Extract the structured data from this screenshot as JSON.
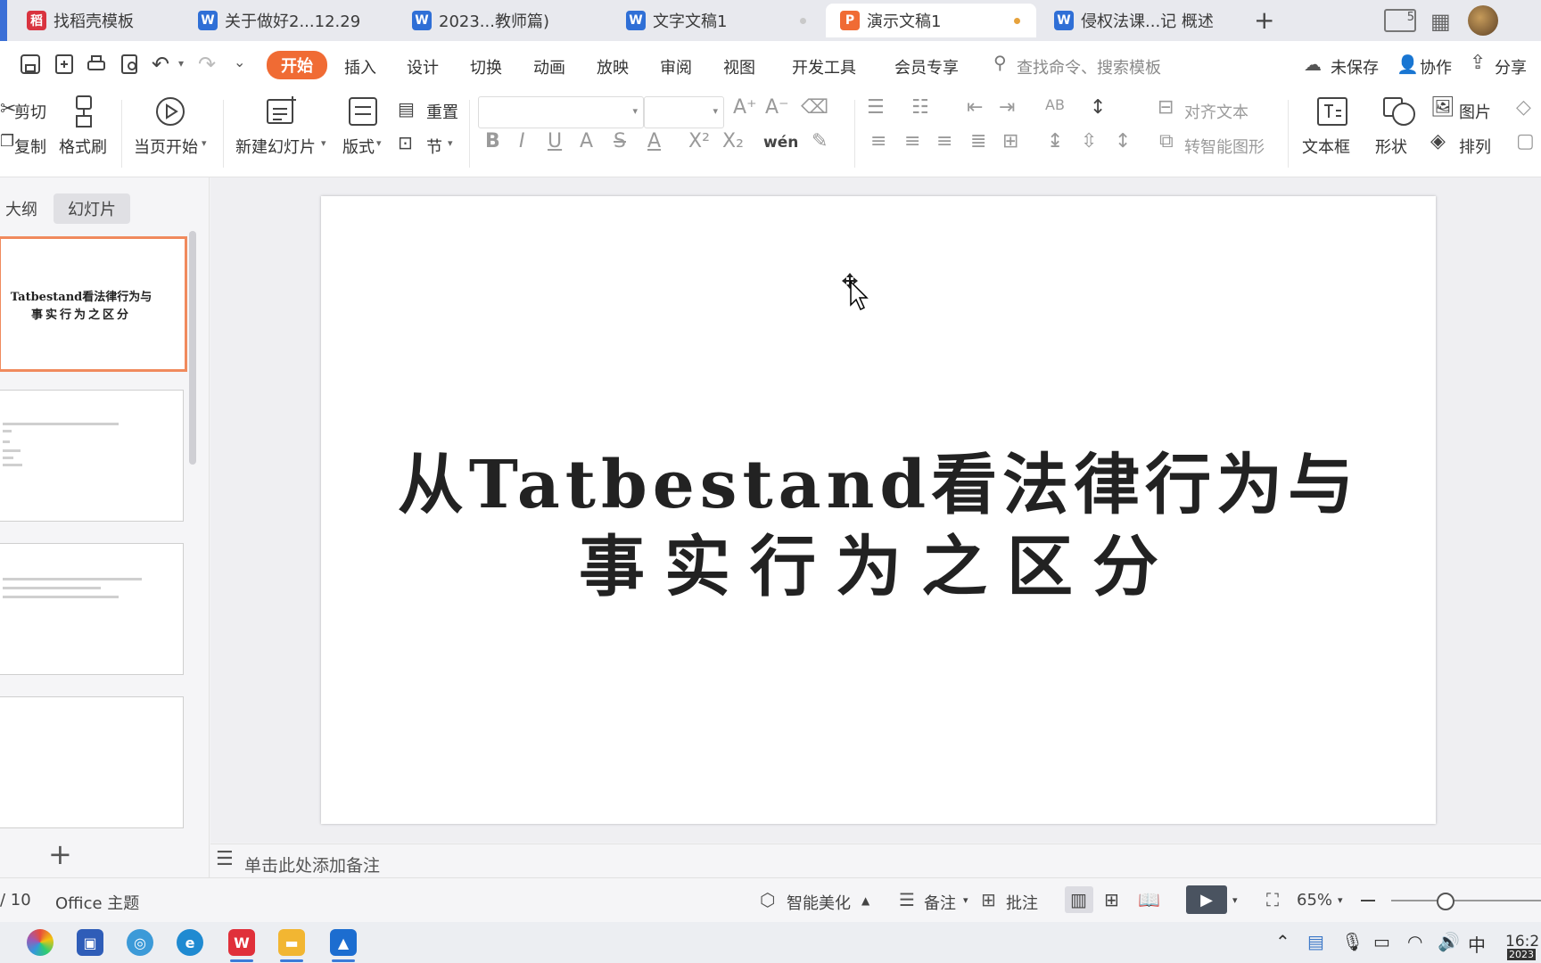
{
  "tabs": [
    {
      "label": "找稻壳模板",
      "icon": "docer-icon",
      "color": "#d9333f"
    },
    {
      "label": "关于做好2...12.29",
      "icon": "wps-writer-icon",
      "color": "#2f6fd6"
    },
    {
      "label": "2023...教师篇)",
      "icon": "wps-writer-icon",
      "color": "#2f6fd6"
    },
    {
      "label": "文字文稿1",
      "icon": "wps-writer-icon",
      "color": "#2f6fd6"
    },
    {
      "label": "演示文稿1",
      "icon": "wps-presentation-icon",
      "color": "#f06b34"
    },
    {
      "label": "侵权法课...记 概述",
      "icon": "wps-writer-icon",
      "color": "#2f6fd6"
    }
  ],
  "menu": {
    "items": [
      "开始",
      "插入",
      "设计",
      "切换",
      "动画",
      "放映",
      "审阅",
      "视图",
      "开发工具",
      "会员专享"
    ],
    "search_placeholder": "查找命令、搜索模板",
    "unsaved": "未保存",
    "collab": "协作",
    "share": "分享"
  },
  "ribbon": {
    "cut": "剪切",
    "copy": "复制",
    "format_painter": "格式刷",
    "play_from_current": "当页开始",
    "new_slide": "新建幻灯片",
    "layout": "版式",
    "reset": "重置",
    "section": "节",
    "align_text": "对齐文本",
    "smart_art": "转智能图形",
    "textbox": "文本框",
    "shape": "形状",
    "picture": "图片",
    "arrange": "排列",
    "phonetic": "wén"
  },
  "panel": {
    "outline_tab": "大纲",
    "slides_tab": "幻灯片",
    "thumb1_line1": "Tatbestand看法律行为与",
    "thumb1_line2": "事实行为之区分"
  },
  "slide": {
    "title_line1": "从Tatbestand看法律行为与",
    "title_line2": "事实行为之区分"
  },
  "notes": {
    "placeholder": "单击此处添加备注"
  },
  "status": {
    "page": "/ 10",
    "theme": "Office 主题",
    "beautify": "智能美化",
    "notes": "备注",
    "comments": "批注",
    "zoom": "65%"
  },
  "tray": {
    "ime": "中",
    "time": "16:2",
    "date": "2023"
  },
  "colors": {
    "accent": "#f06b34",
    "selection": "#f08a5d"
  }
}
